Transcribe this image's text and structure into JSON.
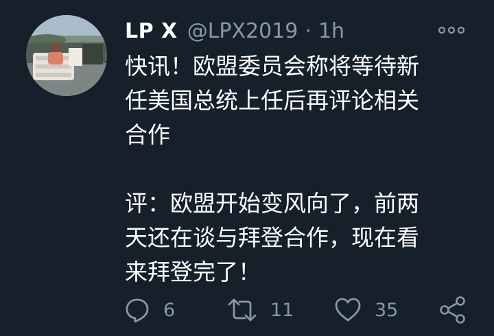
{
  "tweet": {
    "author_name": "LP X",
    "handle": "@LPX2019",
    "separator": "·",
    "time": "1h",
    "text_lines": [
      "快讯！欧盟委员会称将等待新",
      "任美国总统上任后再评论相关",
      "合作",
      "评：欧盟开始变风向了，前两",
      "天还在谈与拜登合作，现在看",
      "来拜登完了！"
    ],
    "actions": {
      "reply_count": "6",
      "retweet_count": "11",
      "like_count": "35"
    }
  },
  "icons": {
    "avatar": "profile-photo",
    "more": "more-options-icon",
    "reply": "reply-icon",
    "retweet": "retweet-icon",
    "like": "heart-icon",
    "share": "share-icon"
  },
  "colors": {
    "background": "#15202b",
    "primary_text": "#ffffff",
    "secondary_text": "#8899a6"
  }
}
